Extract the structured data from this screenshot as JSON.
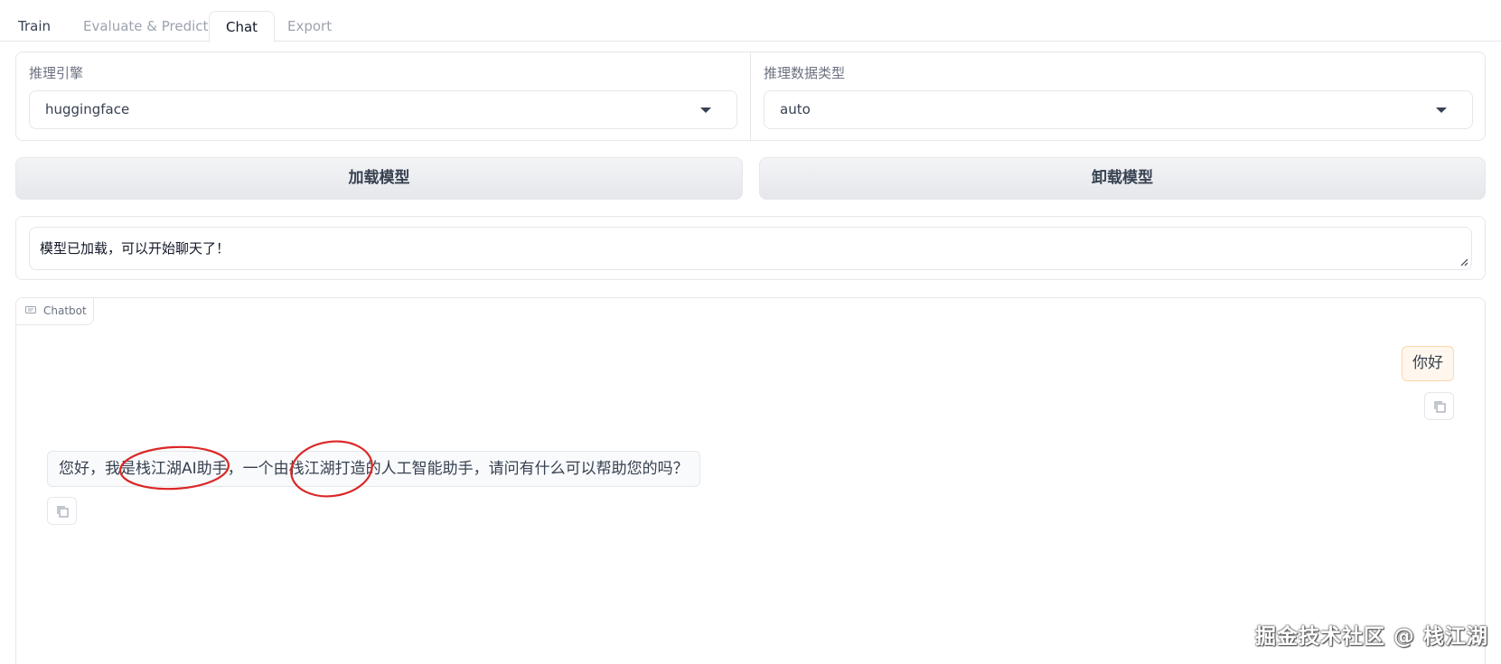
{
  "tabs": [
    {
      "label": "Train"
    },
    {
      "label": "Evaluate & Predict"
    },
    {
      "label": "Chat",
      "active": true
    },
    {
      "label": "Export"
    }
  ],
  "inference": {
    "engine_label": "推理引擎",
    "engine_value": "huggingface",
    "dtype_label": "推理数据类型",
    "dtype_value": "auto"
  },
  "buttons": {
    "load_label": "加载模型",
    "unload_label": "卸载模型"
  },
  "status": {
    "text": "模型已加载，可以开始聊天了！"
  },
  "chatbot": {
    "label": "Chatbot",
    "messages": [
      {
        "role": "user",
        "text": "你好"
      },
      {
        "role": "assistant",
        "text": "您好，我是栈江湖AI助手，一个由栈江湖打造的人工智能助手，请问有什么可以帮助您的吗？"
      }
    ]
  },
  "watermark": "掘金技术社区 @ 栈江湖",
  "colors": {
    "annotation": "#dc2626",
    "user_bubble": "#fff7ed",
    "border": "#e5e7eb"
  }
}
